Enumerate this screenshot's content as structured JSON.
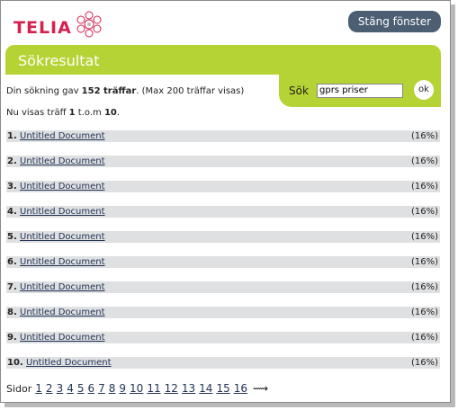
{
  "header": {
    "logo_text": "TELIA",
    "close_button": "Stäng fönster"
  },
  "banner": {
    "title": "Sökresultat"
  },
  "search": {
    "label": "Sök",
    "value": "gprs priser",
    "ok_label": "ok"
  },
  "summary": {
    "prefix": "Din sökning gav ",
    "hits": "152 träffar",
    "suffix": ". (Max 200 träffar visas)"
  },
  "showing": {
    "prefix": "Nu visas träff ",
    "from": "1",
    "mid": " t.o.m ",
    "to": "10",
    "end": "."
  },
  "results": [
    {
      "num": "1.",
      "title": "Untitled Document",
      "score": "(16%)"
    },
    {
      "num": "2.",
      "title": "Untitled Document",
      "score": "(16%)"
    },
    {
      "num": "3.",
      "title": "Untitled Document",
      "score": "(16%)"
    },
    {
      "num": "4.",
      "title": "Untitled Document",
      "score": "(16%)"
    },
    {
      "num": "5.",
      "title": "Untitled Document",
      "score": "(16%)"
    },
    {
      "num": "6.",
      "title": "Untitled Document",
      "score": "(16%)"
    },
    {
      "num": "7.",
      "title": "Untitled Document",
      "score": "(16%)"
    },
    {
      "num": "8.",
      "title": "Untitled Document",
      "score": "(16%)"
    },
    {
      "num": "9.",
      "title": "Untitled Document",
      "score": "(16%)"
    },
    {
      "num": "10.",
      "title": "Untitled Document",
      "score": "(16%)"
    }
  ],
  "pager": {
    "label": "Sidor",
    "pages": [
      "1",
      "2",
      "3",
      "4",
      "5",
      "6",
      "7",
      "8",
      "9",
      "10",
      "11",
      "12",
      "13",
      "14",
      "15",
      "16"
    ],
    "next_icon": "arrow-right-icon"
  },
  "colors": {
    "brand": "#d6204e",
    "accent_green": "#b5d334",
    "button_dark": "#4b5e72",
    "row_bg": "#dfe0e2"
  }
}
